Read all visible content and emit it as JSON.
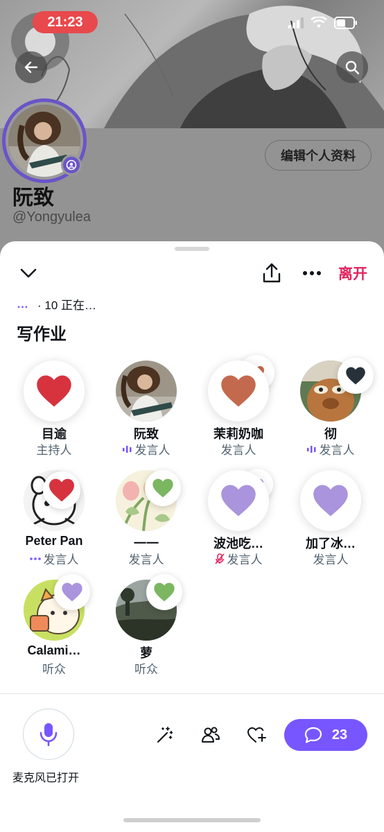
{
  "status_bar": {
    "time": "21:23"
  },
  "profile": {
    "name": "阮致",
    "handle": "@Yongyulea",
    "edit_button": "编辑个人资料"
  },
  "space": {
    "listening_dots": "…",
    "listening_text": "· 10 正在…",
    "title": "写作业",
    "leave_label": "离开"
  },
  "participants": [
    {
      "name": "目逾",
      "role": "主持人",
      "reaction": "heart",
      "reaction_color": "#d6333f",
      "avatar": "heart-placeholder",
      "role_icon": ""
    },
    {
      "name": "阮致",
      "role": "发言人",
      "reaction": "",
      "reaction_color": "",
      "avatar": "photo-woman-guitar",
      "role_icon": "speaking-bars"
    },
    {
      "name": "茉莉奶咖",
      "role": "发言人",
      "reaction": "heart",
      "reaction_color": "#c3694e",
      "avatar": "heart-placeholder",
      "role_icon": ""
    },
    {
      "name": "彻",
      "role": "发言人",
      "reaction": "heart",
      "reaction_color": "#27313a",
      "avatar": "photo-plush",
      "role_icon": "speaking-bars"
    },
    {
      "name": "Peter Pan",
      "role": "发言人",
      "reaction": "heart",
      "reaction_color": "#d6333f",
      "avatar": "drawing-character",
      "role_icon": "typing-dots"
    },
    {
      "name": "一一",
      "role": "发言人",
      "reaction": "heart",
      "reaction_color": "#7bb661",
      "avatar": "drawing-flowers",
      "role_icon": ""
    },
    {
      "name": "波池吃…",
      "role": "发言人",
      "reaction": "heart",
      "reaction_color": "#a994dd",
      "avatar": "heart-placeholder",
      "role_icon": "muted-mic"
    },
    {
      "name": "加了冰…",
      "role": "发言人",
      "reaction": "heart",
      "reaction_color": "#a994dd",
      "avatar": "heart-placeholder",
      "role_icon": ""
    },
    {
      "name": "Calami…",
      "role": "听众",
      "reaction": "heart",
      "reaction_color": "#a994dd",
      "avatar": "drawing-cat",
      "role_icon": ""
    },
    {
      "name": "萝",
      "role": "听众",
      "reaction": "heart",
      "reaction_color": "#7bb661",
      "avatar": "photo-landscape",
      "role_icon": ""
    }
  ],
  "bottom_bar": {
    "mic_label": "麦克风已打开",
    "comment_count": "23"
  },
  "colors": {
    "accent": "#7856ff",
    "leave": "#e0245e",
    "profile_ring": "#6b54c7"
  }
}
